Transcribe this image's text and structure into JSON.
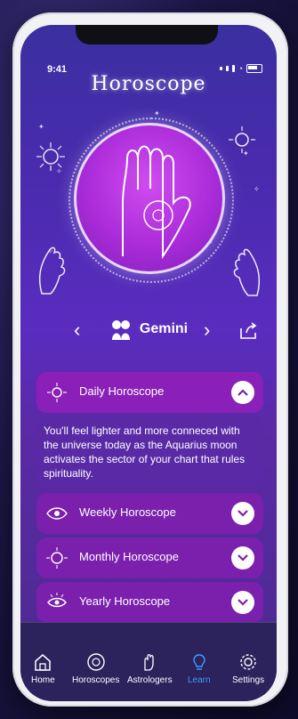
{
  "status": {
    "time": "9:41"
  },
  "header": {
    "title": "Horoscope"
  },
  "sign": {
    "name": "Gemini"
  },
  "sections": {
    "daily": {
      "label": "Daily Horoscope",
      "expanded": true,
      "text": "You'll feel lighter and more conneced with the universe today as the Aquarius moon activates the sector of your chart that rules spirituality."
    },
    "items": [
      {
        "label": "Weekly Horoscope"
      },
      {
        "label": "Monthly Horoscope"
      },
      {
        "label": "Yearly Horoscope"
      }
    ]
  },
  "tabs": [
    {
      "label": "Home"
    },
    {
      "label": "Horoscopes"
    },
    {
      "label": "Astrologers"
    },
    {
      "label": "Learn"
    },
    {
      "label": "Settings"
    }
  ],
  "colors": {
    "accent": "#3aa0ff"
  }
}
